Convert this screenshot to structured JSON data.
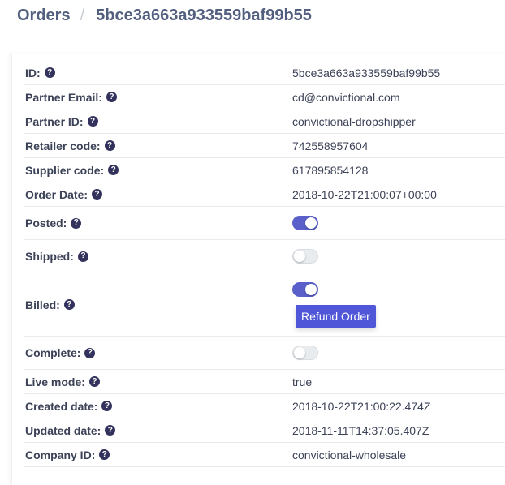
{
  "breadcrumb": {
    "section": "Orders",
    "separator": "/",
    "current": "5bce3a663a933559baf99b55"
  },
  "fields": {
    "id": {
      "label": "ID:",
      "value": "5bce3a663a933559baf99b55"
    },
    "partner_email": {
      "label": "Partner Email:",
      "value": "cd@convictional.com"
    },
    "partner_id": {
      "label": "Partner ID:",
      "value": "convictional-dropshipper"
    },
    "retailer_code": {
      "label": "Retailer code:",
      "value": "742558957604"
    },
    "supplier_code": {
      "label": "Supplier code:",
      "value": "617895854128"
    },
    "order_date": {
      "label": "Order Date:",
      "value": "2018-10-22T21:00:07+00:00"
    },
    "posted": {
      "label": "Posted:",
      "on": true
    },
    "shipped": {
      "label": "Shipped:",
      "on": false
    },
    "billed": {
      "label": "Billed:",
      "on": true,
      "button": "Refund Order"
    },
    "complete": {
      "label": "Complete:",
      "on": false
    },
    "live_mode": {
      "label": "Live mode:",
      "value": "true"
    },
    "created_date": {
      "label": "Created date:",
      "value": "2018-10-22T21:00:22.474Z"
    },
    "updated_date": {
      "label": "Updated date:",
      "value": "2018-11-11T14:37:05.407Z"
    },
    "company_id": {
      "label": "Company ID:",
      "value": "convictional-wholesale"
    }
  },
  "help_glyph": "?",
  "colors": {
    "accent": "#5a5fc9",
    "button": "#4f56d8",
    "help_icon": "#32325d"
  }
}
